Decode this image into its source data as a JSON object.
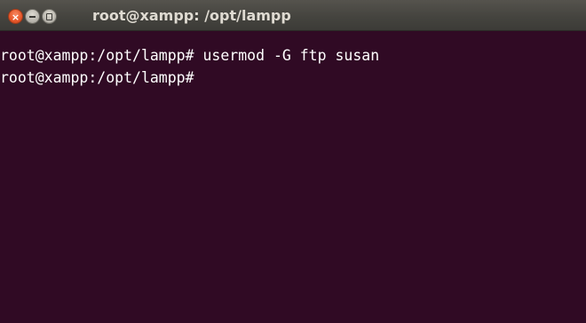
{
  "window": {
    "title": "root@xampp: /opt/lampp",
    "close_symbol": "×"
  },
  "terminal": {
    "lines": [
      {
        "prompt": "root@xampp:/opt/lampp#",
        "command": " usermod -G ftp susan"
      },
      {
        "prompt": "root@xampp:/opt/lampp#",
        "command": ""
      }
    ]
  },
  "colors": {
    "terminal_background": "#300a24",
    "titlebar": "#3c3b37",
    "close_button": "#e9592b",
    "text": "#ffffff",
    "title_text": "#dfdbd2"
  },
  "icons": [
    "close-icon",
    "minimize-icon",
    "maximize-icon"
  ]
}
